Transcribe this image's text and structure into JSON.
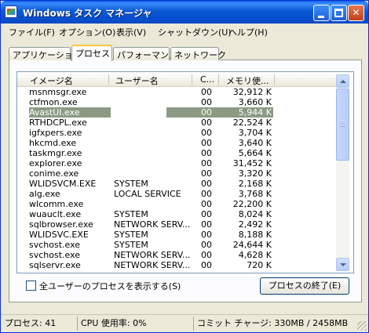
{
  "window": {
    "title": "Windows タスク マネージャ",
    "min_label": "",
    "max_label": "",
    "close_label": "✕"
  },
  "menu": [
    {
      "label": "ファイル(F)"
    },
    {
      "label": "オプション(O)"
    },
    {
      "label": "表示(V)"
    },
    {
      "label": "シャットダウン(U)"
    },
    {
      "label": "ヘルプ(H)"
    }
  ],
  "tabs": [
    {
      "label": "アプリケーション",
      "active": false
    },
    {
      "label": "プロセス",
      "active": true
    },
    {
      "label": "パフォーマンス",
      "active": false
    },
    {
      "label": "ネットワーク",
      "active": false
    }
  ],
  "table": {
    "columns": {
      "name": "イメージ名",
      "user": "ユーザー名",
      "cpu": "C...",
      "mem": "メモリ使..."
    },
    "rows": [
      {
        "name": "msnmsgr.exe",
        "user": "",
        "cpu": "00",
        "mem": "32,912 K"
      },
      {
        "name": "ctfmon.exe",
        "user": "",
        "cpu": "00",
        "mem": "3,660 K"
      },
      {
        "name": "AvastUI.exe",
        "user": "",
        "cpu": "00",
        "mem": "5,944 K",
        "selected": true
      },
      {
        "name": "RTHDCPL.exe",
        "user": "",
        "cpu": "00",
        "mem": "22,524 K"
      },
      {
        "name": "igfxpers.exe",
        "user": "",
        "cpu": "00",
        "mem": "3,704 K"
      },
      {
        "name": "hkcmd.exe",
        "user": "",
        "cpu": "00",
        "mem": "3,640 K"
      },
      {
        "name": "taskmgr.exe",
        "user": "",
        "cpu": "00",
        "mem": "5,664 K"
      },
      {
        "name": "explorer.exe",
        "user": "",
        "cpu": "00",
        "mem": "31,452 K"
      },
      {
        "name": "conime.exe",
        "user": "",
        "cpu": "00",
        "mem": "3,320 K"
      },
      {
        "name": "WLIDSVCM.EXE",
        "user": "SYSTEM",
        "cpu": "00",
        "mem": "2,168 K"
      },
      {
        "name": "alg.exe",
        "user": "LOCAL SERVICE",
        "cpu": "00",
        "mem": "3,768 K"
      },
      {
        "name": "wlcomm.exe",
        "user": "",
        "cpu": "00",
        "mem": "22,200 K"
      },
      {
        "name": "wuauclt.exe",
        "user": "SYSTEM",
        "cpu": "00",
        "mem": "8,024 K"
      },
      {
        "name": "sqlbrowser.exe",
        "user": "NETWORK SERV...",
        "cpu": "00",
        "mem": "2,492 K"
      },
      {
        "name": "WLIDSVC.EXE",
        "user": "SYSTEM",
        "cpu": "00",
        "mem": "8,188 K"
      },
      {
        "name": "svchost.exe",
        "user": "SYSTEM",
        "cpu": "00",
        "mem": "24,644 K"
      },
      {
        "name": "svchost.exe",
        "user": "NETWORK SERV...",
        "cpu": "00",
        "mem": "4,628 K"
      },
      {
        "name": "sqlservr.exe",
        "user": "NETWORK SERV...",
        "cpu": "00",
        "mem": "720 K"
      }
    ]
  },
  "show_all_users": {
    "label": "全ユーザーのプロセスを表示する(S)",
    "checked": false
  },
  "end_process_button": "プロセスの終了(E)",
  "status": {
    "processes": "プロセス: 41",
    "cpu": "CPU 使用率: 0%",
    "commit": "コミット チャージ: 330MB / 2458MB"
  }
}
